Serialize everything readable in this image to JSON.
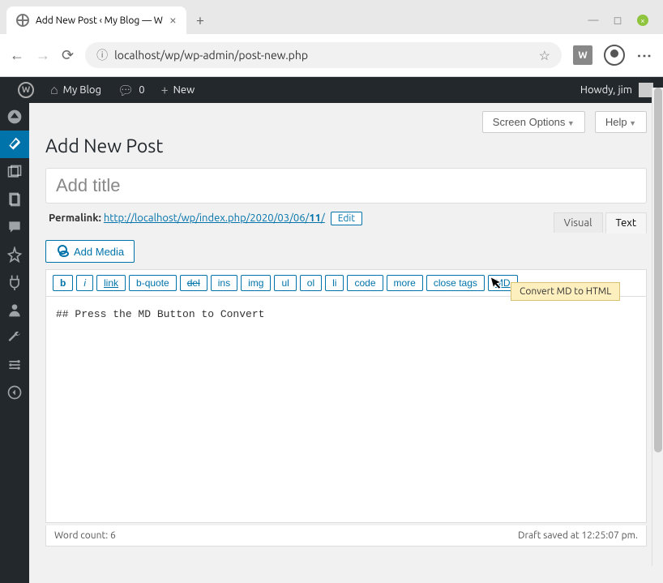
{
  "browser": {
    "tab_title": "Add New Post ‹ My Blog — W",
    "url_display": "localhost/wp/wp-admin/post-new.php",
    "ext_label": "W"
  },
  "adminbar": {
    "site_name": "My Blog",
    "comment_count": "0",
    "new_label": "New",
    "greeting": "Howdy, jim"
  },
  "top_buttons": {
    "screen_options": "Screen Options",
    "help": "Help"
  },
  "page": {
    "heading": "Add New Post",
    "title_placeholder": "Add title"
  },
  "permalink": {
    "label": "Permalink:",
    "url_base": "http://localhost/wp/index.php/2020/03/06/",
    "url_slug": "11",
    "url_tail": "/",
    "edit_label": "Edit"
  },
  "media": {
    "label": "Add Media"
  },
  "tabs": {
    "visual": "Visual",
    "text": "Text"
  },
  "quicktags": {
    "b": "b",
    "i": "i",
    "link": "link",
    "bquote": "b-quote",
    "del": "del",
    "ins": "ins",
    "img": "img",
    "ul": "ul",
    "ol": "ol",
    "li": "li",
    "code": "code",
    "more": "more",
    "close": "close tags",
    "md": "MD"
  },
  "editor": {
    "content": "## Press the MD Button to Convert"
  },
  "tooltip": {
    "text": "Convert MD to HTML"
  },
  "status": {
    "word_count": "Word count: 6",
    "draft_saved": "Draft saved at 12:25:07 pm."
  }
}
